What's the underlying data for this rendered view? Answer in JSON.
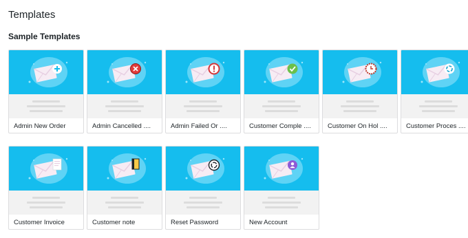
{
  "page": {
    "title": "Templates",
    "section_title": "Sample Templates"
  },
  "colors": {
    "thumb_bg": "#15bdee",
    "cloud": "#5fd3f5",
    "envelope": "#f7ecf4",
    "envelope_flap": "#e7cfe2",
    "card_border": "#dcdcde"
  },
  "templates": [
    {
      "label": "Admin New Order",
      "badge": "plus-icon"
    },
    {
      "label": "Admin Cancelled ....",
      "badge": "x-circle-icon"
    },
    {
      "label": "Admin Failed Or ....",
      "badge": "exclamation-circle-icon"
    },
    {
      "label": "Customer Comple ....",
      "badge": "check-circle-icon"
    },
    {
      "label": "Customer On Hol ....",
      "badge": "clock-icon"
    },
    {
      "label": "Customer Proces ....",
      "badge": "refresh-icon"
    },
    {
      "label": "Customer Invoice",
      "badge": "invoice-icon"
    },
    {
      "label": "Customer note",
      "badge": "note-icon"
    },
    {
      "label": "Reset Password",
      "badge": "reset-icon"
    },
    {
      "label": "New Account",
      "badge": "user-circle-icon"
    }
  ]
}
